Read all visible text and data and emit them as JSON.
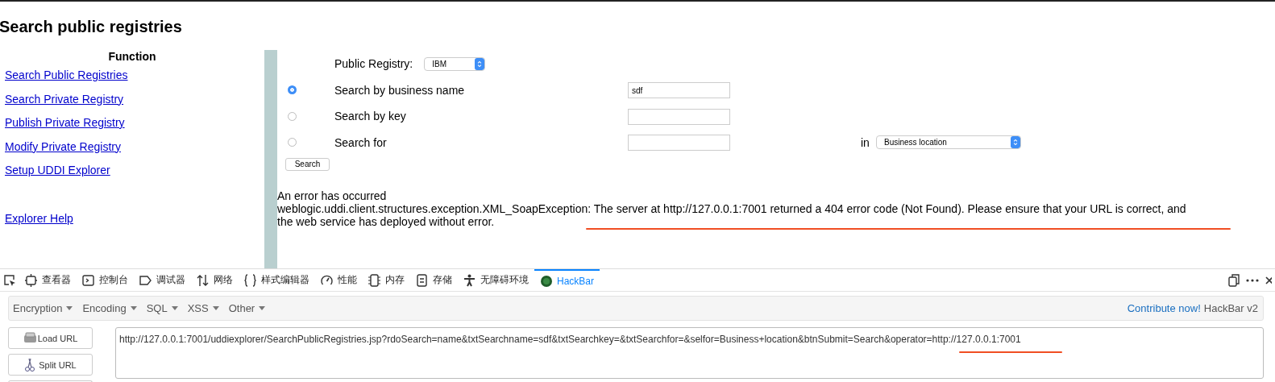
{
  "page_title": "Search public registries",
  "sidebar": {
    "heading": "Function",
    "links": [
      "Search Public Registries",
      "Search Private Registry",
      "Publish Private Registry",
      "Modify Private Registry",
      "Setup UDDI Explorer"
    ],
    "help_link": "Explorer Help"
  },
  "form": {
    "registry": {
      "label": "Public Registry:",
      "value": "IBM"
    },
    "options": [
      {
        "label": "Search by business name",
        "selected": true,
        "value": "sdf"
      },
      {
        "label": "Search by key",
        "selected": false
      },
      {
        "label": "Search for",
        "selected": false,
        "in_label": "in",
        "location": "Business location"
      }
    ],
    "button": "Search"
  },
  "error": {
    "title": "An error has occurred",
    "message": "weblogic.uddi.client.structures.exception.XML_SoapException: The server at http://127.0.0.1:7001 returned a 404 error code (Not Found). Please ensure that your URL is correct, and the web service has deployed without error."
  },
  "devtools": {
    "tabs": [
      {
        "label": "查看器",
        "kind": "inspector",
        "selected": false
      },
      {
        "label": "控制台",
        "kind": "console",
        "selected": false
      },
      {
        "label": "调试器",
        "kind": "debugger",
        "selected": false
      },
      {
        "label": "网络",
        "kind": "network",
        "selected": false
      },
      {
        "label": "样式编辑器",
        "kind": "style",
        "selected": false
      },
      {
        "label": "性能",
        "kind": "performance",
        "selected": false
      },
      {
        "label": "内存",
        "kind": "memory",
        "selected": false
      },
      {
        "label": "存储",
        "kind": "storage",
        "selected": false
      },
      {
        "label": "无障碍环境",
        "kind": "accessibility",
        "selected": false
      },
      {
        "label": "HackBar",
        "kind": "hackbar",
        "selected": true
      }
    ]
  },
  "hackbar": {
    "menus": [
      "Encryption",
      "Encoding",
      "SQL",
      "XSS",
      "Other"
    ],
    "contribute": "Contribute now!",
    "version": "HackBar v2",
    "buttons": [
      {
        "label": "Load URL",
        "kind": "load"
      },
      {
        "label": "Split URL",
        "kind": "split"
      }
    ],
    "url": "http://127.0.0.1:7001/uddiexplorer/SearchPublicRegistries.jsp?rdoSearch=name&txtSearchname=sdf&txtSearchkey=&txtSearchfor=&selfor=Business+location&btnSubmit=Search&operator=http://127.0.0.1:7001"
  }
}
